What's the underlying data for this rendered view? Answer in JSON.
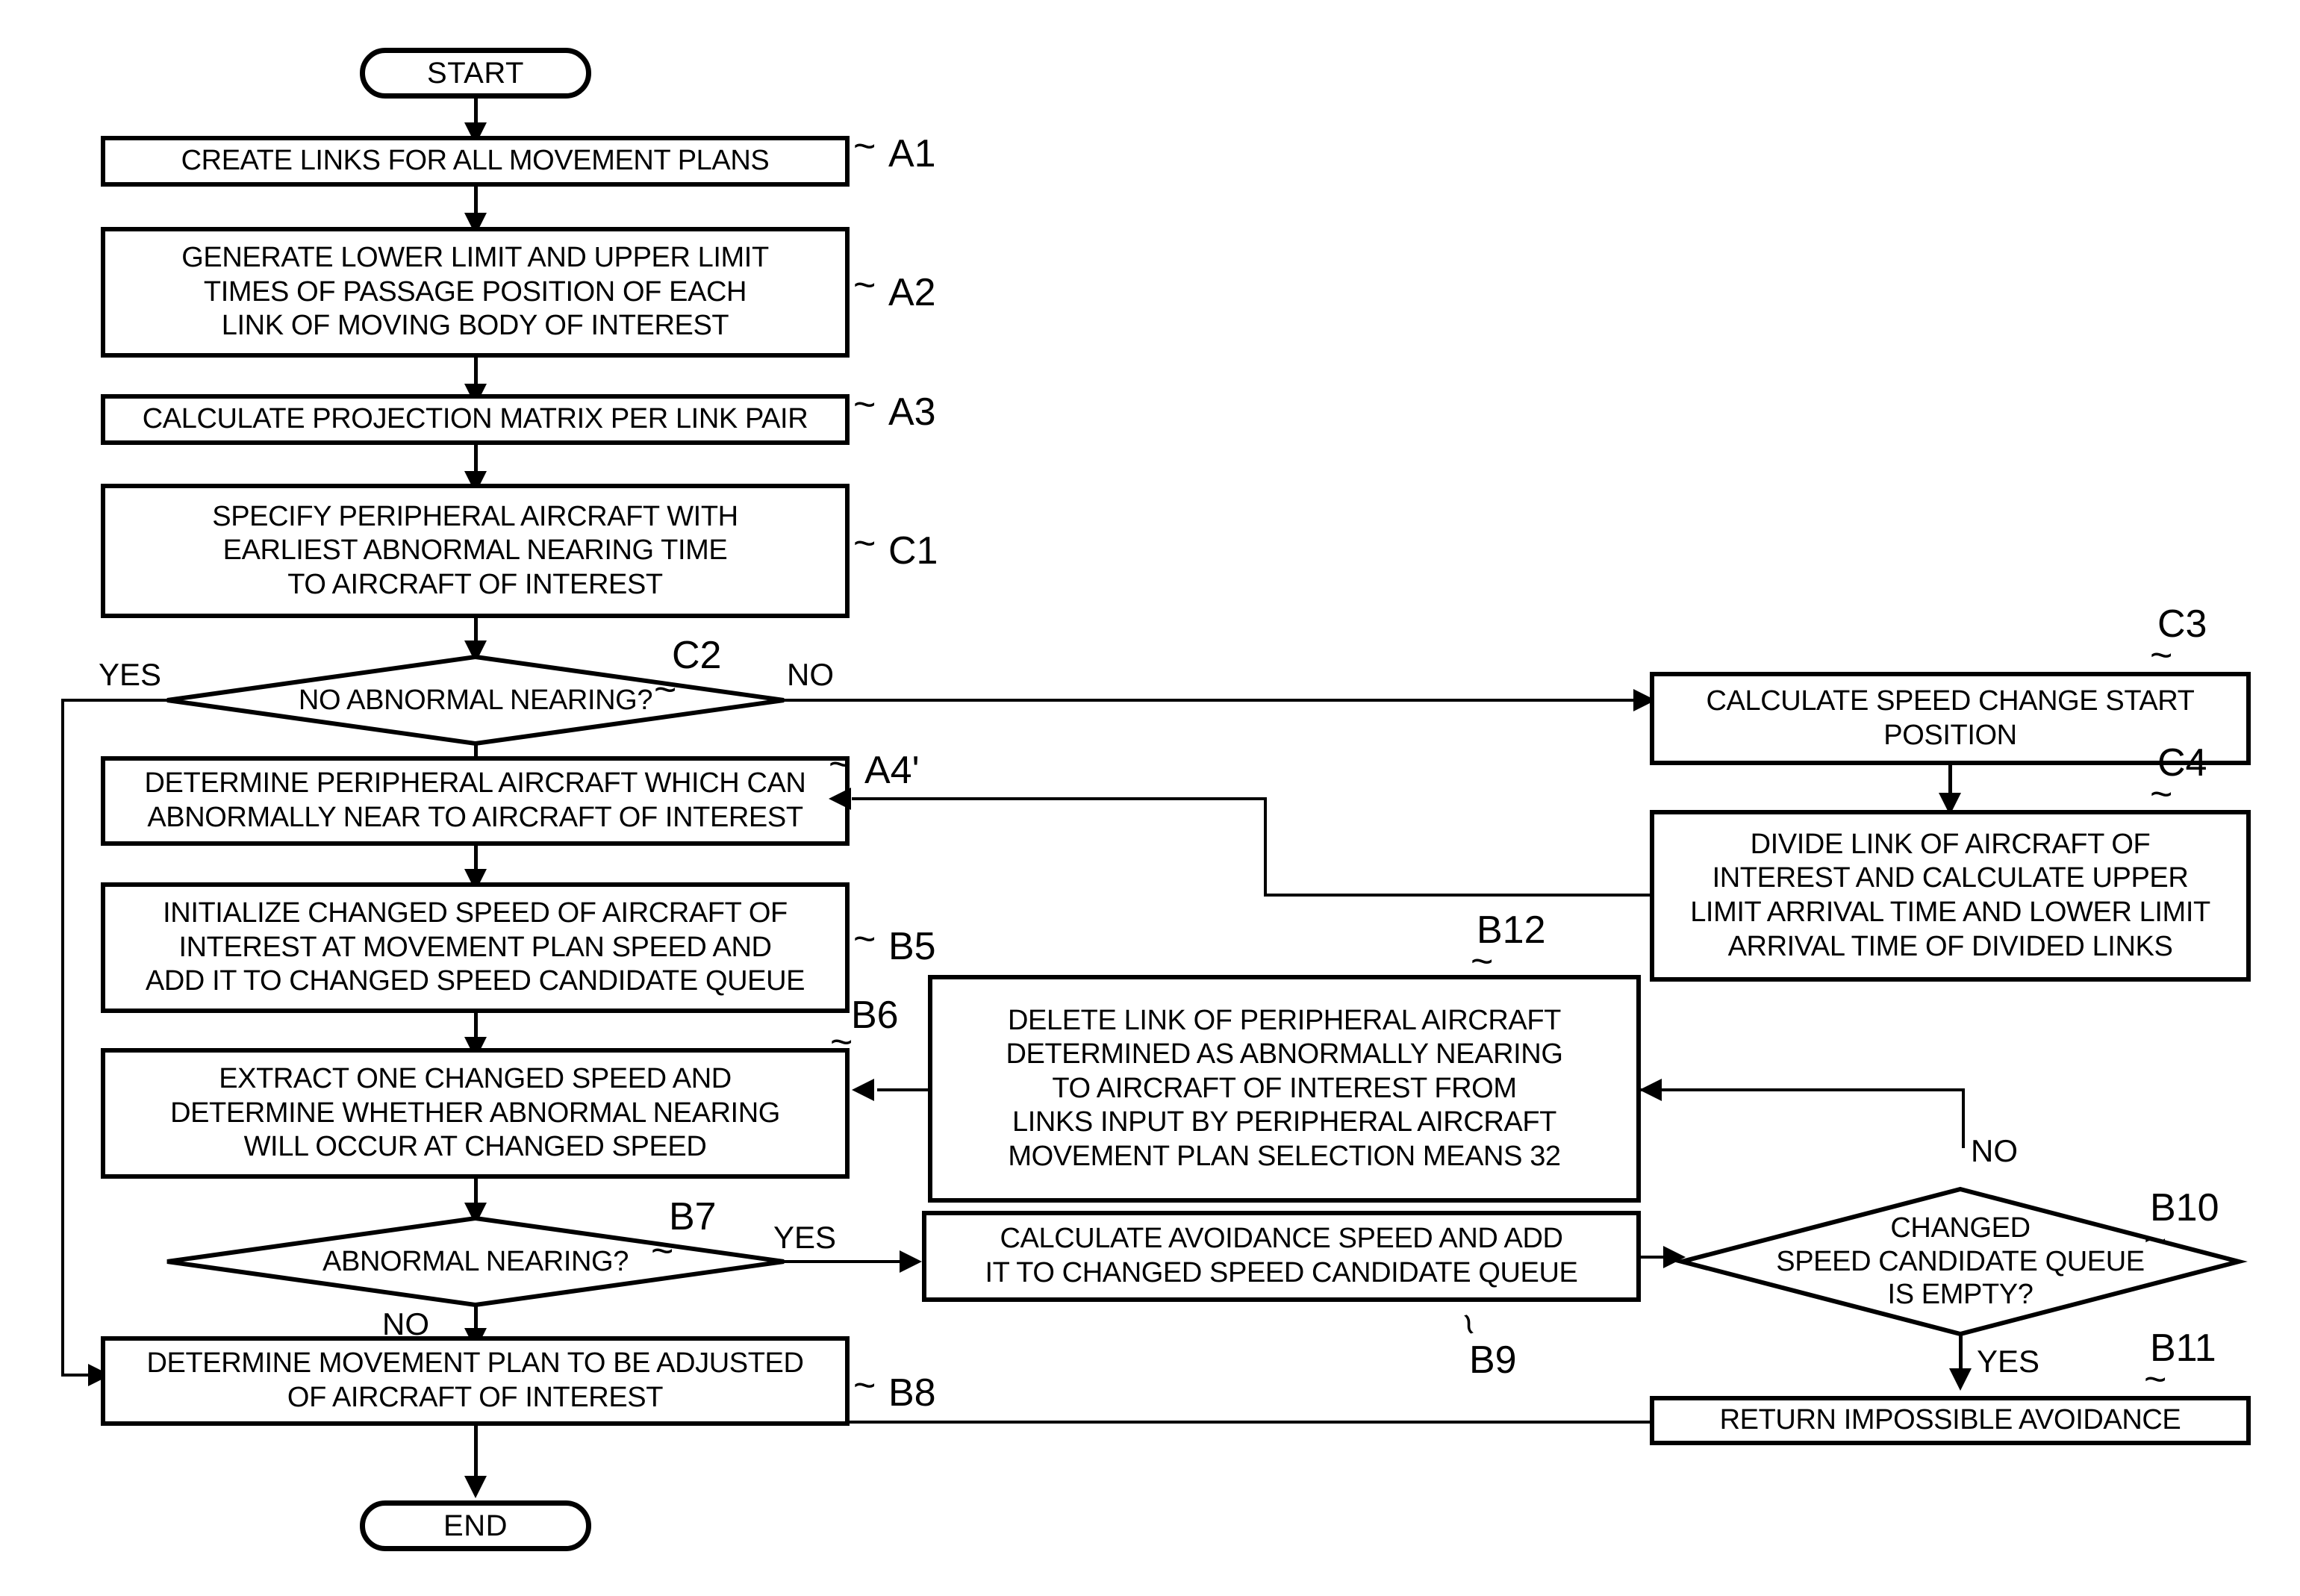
{
  "diagram": {
    "title": "Movement plan speed-change avoidance flowchart",
    "terminals": {
      "start": "START",
      "end": "END"
    },
    "nodes": [
      {
        "id": "A1",
        "ref": "A1",
        "text": "CREATE LINKS FOR ALL MOVEMENT PLANS"
      },
      {
        "id": "A2",
        "ref": "A2",
        "text": "GENERATE LOWER LIMIT AND UPPER LIMIT TIMES OF PASSAGE POSITION OF EACH LINK OF MOVING BODY OF INTEREST",
        "lines": [
          "GENERATE LOWER LIMIT AND UPPER LIMIT",
          "TIMES OF PASSAGE POSITION OF EACH",
          "LINK OF MOVING BODY OF INTEREST"
        ]
      },
      {
        "id": "A3",
        "ref": "A3",
        "text": "CALCULATE PROJECTION MATRIX PER LINK PAIR"
      },
      {
        "id": "C1",
        "ref": "C1",
        "text": "SPECIFY PERIPHERAL AIRCRAFT WITH EARLIEST ABNORMAL NEARING TIME TO AIRCRAFT OF INTEREST",
        "lines": [
          "SPECIFY PERIPHERAL AIRCRAFT WITH",
          "EARLIEST ABNORMAL NEARING TIME",
          "TO AIRCRAFT OF INTEREST"
        ]
      },
      {
        "id": "C2",
        "ref": "C2",
        "text": "NO ABNORMAL NEARING?",
        "shape": "diamond"
      },
      {
        "id": "C3",
        "ref": "C3",
        "text": "CALCULATE SPEED CHANGE START POSITION",
        "lines": [
          "CALCULATE SPEED CHANGE START",
          "POSITION"
        ]
      },
      {
        "id": "C4",
        "ref": "C4",
        "text": "DIVIDE LINK OF AIRCRAFT OF INTEREST AND CALCULATE UPPER LIMIT ARRIVAL TIME AND LOWER LIMIT ARRIVAL TIME OF DIVIDED LINKS",
        "lines": [
          "DIVIDE LINK OF AIRCRAFT OF",
          "INTEREST AND CALCULATE UPPER",
          "LIMIT ARRIVAL TIME AND LOWER LIMIT",
          "ARRIVAL TIME OF DIVIDED LINKS"
        ]
      },
      {
        "id": "A4p",
        "ref": "A4'",
        "text": "DETERMINE PERIPHERAL AIRCRAFT WHICH CAN ABNORMALLY NEAR TO AIRCRAFT OF INTEREST",
        "lines": [
          "DETERMINE PERIPHERAL AIRCRAFT WHICH CAN",
          "ABNORMALLY NEAR TO AIRCRAFT OF INTEREST"
        ]
      },
      {
        "id": "B5",
        "ref": "B5",
        "text": "INITIALIZE CHANGED SPEED OF AIRCRAFT OF INTEREST AT MOVEMENT PLAN SPEED AND ADD IT TO CHANGED SPEED CANDIDATE QUEUE",
        "lines": [
          "INITIALIZE CHANGED SPEED OF AIRCRAFT OF",
          "INTEREST AT MOVEMENT PLAN SPEED AND",
          "ADD IT TO CHANGED SPEED CANDIDATE QUEUE"
        ]
      },
      {
        "id": "B6",
        "ref": "B6",
        "text": "EXTRACT ONE CHANGED SPEED AND DETERMINE WHETHER ABNORMAL NEARING WILL OCCUR AT CHANGED SPEED",
        "lines": [
          "EXTRACT ONE CHANGED SPEED AND",
          "DETERMINE WHETHER ABNORMAL NEARING",
          "WILL OCCUR AT CHANGED SPEED"
        ]
      },
      {
        "id": "B12",
        "ref": "B12",
        "text": "DELETE LINK OF PERIPHERAL AIRCRAFT DETERMINED AS ABNORMALLY NEARING TO AIRCRAFT OF INTEREST FROM LINKS INPUT BY PERIPHERAL AIRCRAFT MOVEMENT PLAN SELECTION MEANS 32",
        "lines": [
          "DELETE LINK OF PERIPHERAL AIRCRAFT",
          "DETERMINED AS ABNORMALLY NEARING",
          "TO AIRCRAFT OF INTEREST FROM",
          "LINKS INPUT BY PERIPHERAL AIRCRAFT",
          "MOVEMENT PLAN SELECTION MEANS 32"
        ]
      },
      {
        "id": "B7",
        "ref": "B7",
        "text": "ABNORMAL NEARING?",
        "shape": "diamond"
      },
      {
        "id": "B9",
        "ref": "B9",
        "text": "CALCULATE AVOIDANCE SPEED AND ADD IT TO CHANGED SPEED CANDIDATE QUEUE",
        "lines": [
          "CALCULATE AVOIDANCE SPEED AND ADD",
          "IT TO CHANGED SPEED CANDIDATE QUEUE"
        ]
      },
      {
        "id": "B10",
        "ref": "B10",
        "text": "CHANGED SPEED CANDIDATE QUEUE IS EMPTY?",
        "shape": "diamond",
        "lines": [
          "CHANGED",
          "SPEED CANDIDATE QUEUE",
          "IS EMPTY?"
        ]
      },
      {
        "id": "B11",
        "ref": "B11",
        "text": "RETURN IMPOSSIBLE AVOIDANCE"
      },
      {
        "id": "B8",
        "ref": "B8",
        "text": "DETERMINE MOVEMENT PLAN TO BE ADJUSTED OF AIRCRAFT OF INTEREST",
        "lines": [
          "DETERMINE MOVEMENT PLAN TO BE ADJUSTED",
          "OF AIRCRAFT OF INTEREST"
        ]
      }
    ],
    "edge_labels": {
      "c2_yes": "YES",
      "c2_no": "NO",
      "b7_yes": "YES",
      "b7_no": "NO",
      "b10_no": "NO",
      "b10_yes": "YES"
    }
  }
}
